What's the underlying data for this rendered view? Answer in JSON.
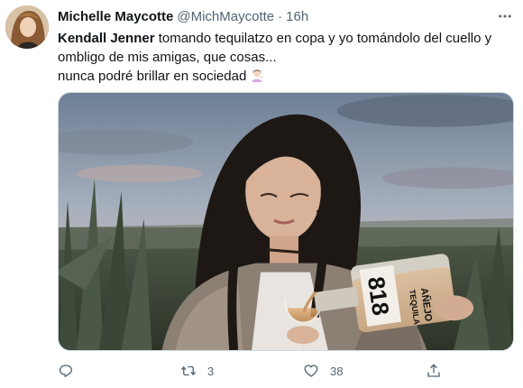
{
  "author": {
    "name": "Michelle Maycotte",
    "handle": "@MichMaycotte",
    "separator": "·",
    "time": "16h"
  },
  "tweet": {
    "mention": "Kendall Jenner",
    "line1_rest": " tomando tequilatzo en copa y yo tomándolo del cuello y",
    "line2": "ombligo de mis amigas, que cosas...",
    "line3": "nunca podré brillar en sociedad",
    "emoji": "woman-tipping-hand-emoji"
  },
  "media": {
    "bottle_number": "818",
    "bottle_label_line1": "TEQUILA",
    "bottle_label_line2": "AÑEJO"
  },
  "actions": {
    "reply_count": "",
    "retweet_count": "3",
    "like_count": "38"
  },
  "icons": {
    "more": "more-horizontal-icon",
    "reply": "reply-icon",
    "retweet": "retweet-icon",
    "like": "heart-icon",
    "share": "share-icon"
  },
  "colors": {
    "text": "#0f1419",
    "secondary": "#536471",
    "border": "#cfd9de"
  }
}
